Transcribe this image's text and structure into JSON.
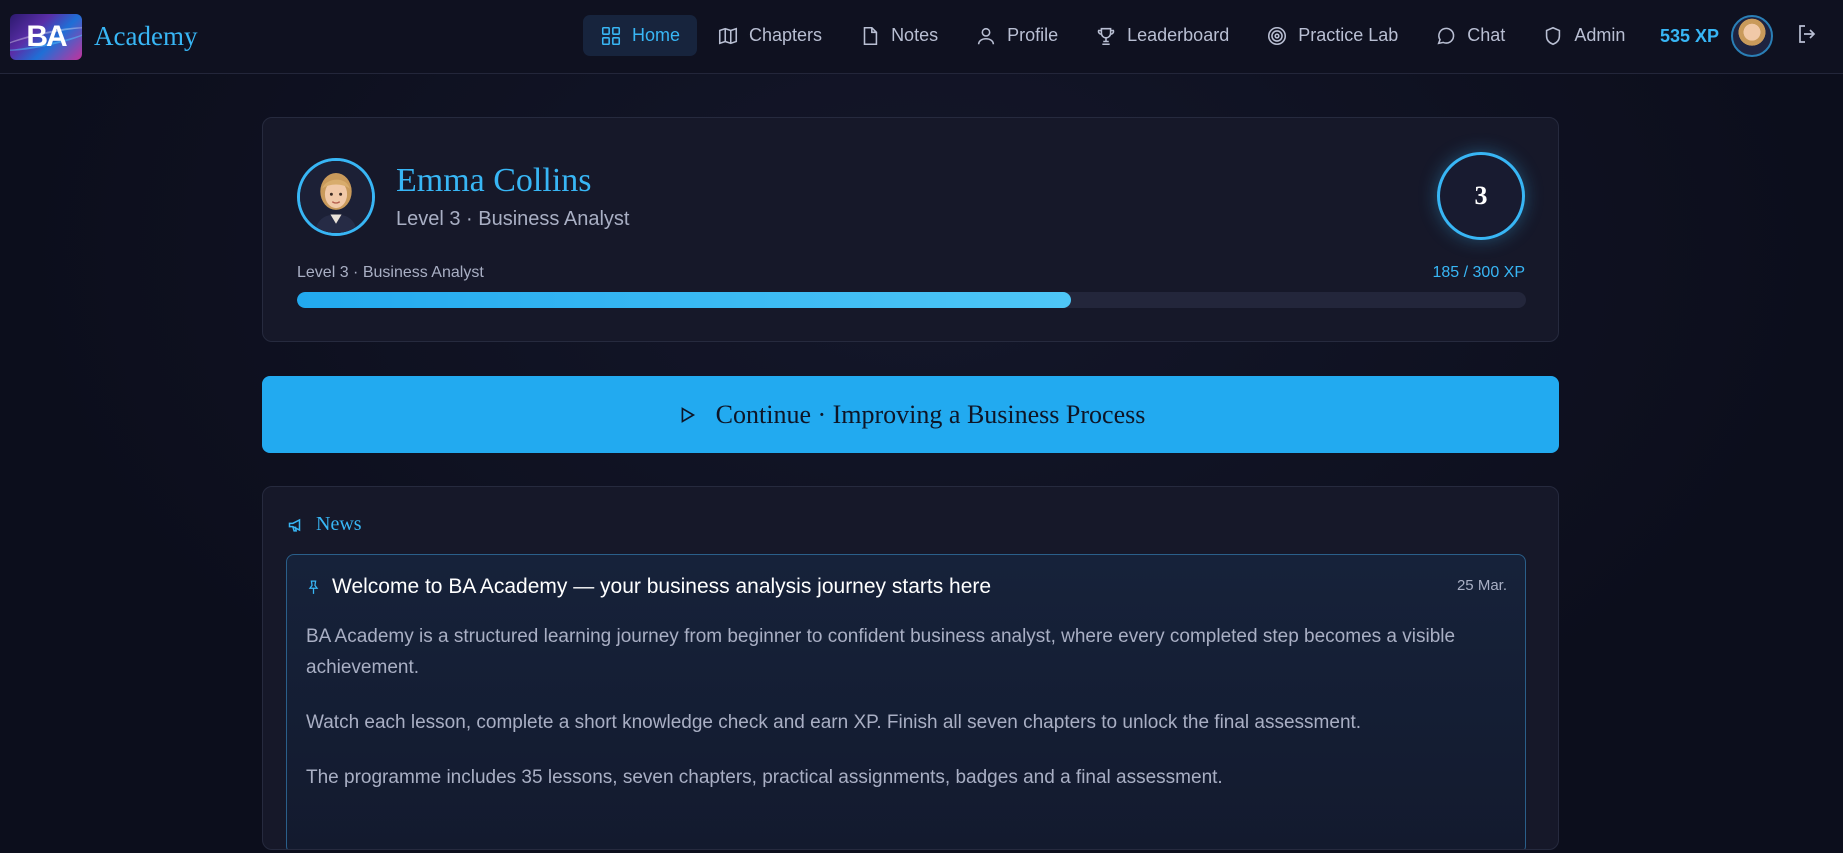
{
  "brand": {
    "logo_text": "BA",
    "name": "Academy"
  },
  "nav": {
    "items": [
      {
        "label": "Home",
        "icon": "grid-icon",
        "active": true
      },
      {
        "label": "Chapters",
        "icon": "map-icon",
        "active": false
      },
      {
        "label": "Notes",
        "icon": "file-icon",
        "active": false
      },
      {
        "label": "Profile",
        "icon": "user-icon",
        "active": false
      },
      {
        "label": "Leaderboard",
        "icon": "trophy-icon",
        "active": false
      },
      {
        "label": "Practice Lab",
        "icon": "target-icon",
        "active": false
      },
      {
        "label": "Chat",
        "icon": "chat-icon",
        "active": false
      },
      {
        "label": "Admin",
        "icon": "shield-icon",
        "active": false
      }
    ],
    "xp": "535 XP"
  },
  "profile": {
    "name": "Emma Collins",
    "subtitle": "Level 3 · Business Analyst",
    "level": "3",
    "progress_label": "Level 3 · Business Analyst",
    "progress_count": "185 / 300 XP",
    "progress_fraction": 0.63
  },
  "continue": {
    "label": "Continue · Improving a Business Process"
  },
  "news": {
    "heading": "News",
    "post": {
      "title": "Welcome to BA Academy — your business analysis journey starts here",
      "date": "25 Mar.",
      "paragraphs": [
        "BA Academy is a structured learning journey from beginner to confident business analyst, where every completed step becomes a visible achievement.",
        "Watch each lesson, complete a short knowledge check and earn XP. Finish all seven chapters to unlock the final assessment.",
        "The programme includes 35 lessons, seven chapters, practical assignments, badges and a final assessment."
      ]
    }
  },
  "colors": {
    "accent": "#38b6f5",
    "button": "#22aaf0",
    "background": "#0d0f1e"
  }
}
